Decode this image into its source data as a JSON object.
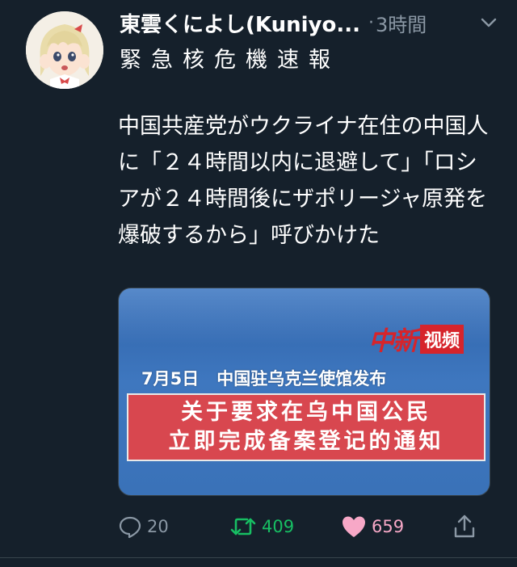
{
  "tweet": {
    "display_name": "東雲くによし(Kuniyo...",
    "dot": "·",
    "timestamp": "3時間",
    "subtitle": "緊急核危機速報",
    "text": "中国共産党がウクライナ在住の中国人に「２４時間以内に退避して」「ロシアが２４時間後にザポリージャ原発を爆破するから」呼びかけた",
    "media": {
      "logo_red": "中新",
      "logo_box": "视频",
      "date": "7月5日",
      "source": "中国驻乌克兰使馆发布",
      "banner_line1": "关于要求在乌中国公民",
      "banner_line2": "立即完成备案登记的通知"
    },
    "actions": {
      "reply_count": "20",
      "retweet_count": "409",
      "like_count": "659"
    }
  },
  "colors": {
    "background": "#15202b",
    "muted": "#8b98a5",
    "retweet_green": "#17bf63",
    "like_pink": "#f7a8c7",
    "banner_red": "#d8474f"
  },
  "icons": {
    "chevron": "chevron-down-icon",
    "reply": "reply-icon",
    "retweet": "retweet-icon",
    "like": "heart-icon",
    "share": "share-icon"
  }
}
